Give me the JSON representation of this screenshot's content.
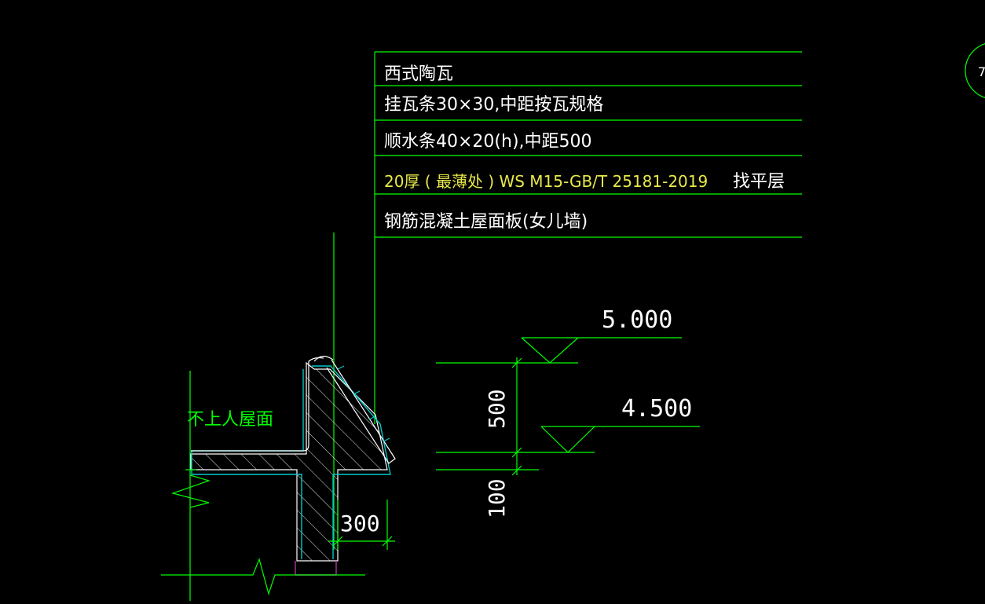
{
  "layers": [
    {
      "text": "西式陶瓦",
      "color": "#ffffff"
    },
    {
      "text": "挂瓦条30×30,中距按瓦规格",
      "color": "#ffffff"
    },
    {
      "text": "顺水条40×20(h),中距500",
      "color": "#ffffff"
    },
    {
      "text": "20厚 ( 最薄处 ) WS M15-GB/T 25181-2019",
      "suffix": "找平层",
      "color": "#e8e84a",
      "suffix_color": "#ffffff"
    },
    {
      "text": "钢筋混凝土屋面板(女儿墙)",
      "color": "#ffffff"
    }
  ],
  "elevations": {
    "upper": "5.000",
    "lower": "4.500"
  },
  "dimensions": {
    "vertical_500": "500",
    "vertical_100": "100",
    "horizontal_300": "300"
  },
  "roof_label": "不上人屋面",
  "sheet_marker": "7",
  "colors": {
    "background": "#000000",
    "line_green": "#00ff00",
    "hatch_white": "#ffffff",
    "cyan": "#00c8c8",
    "yellow_text": "#e8e84a",
    "magenta": "#c040c0"
  }
}
